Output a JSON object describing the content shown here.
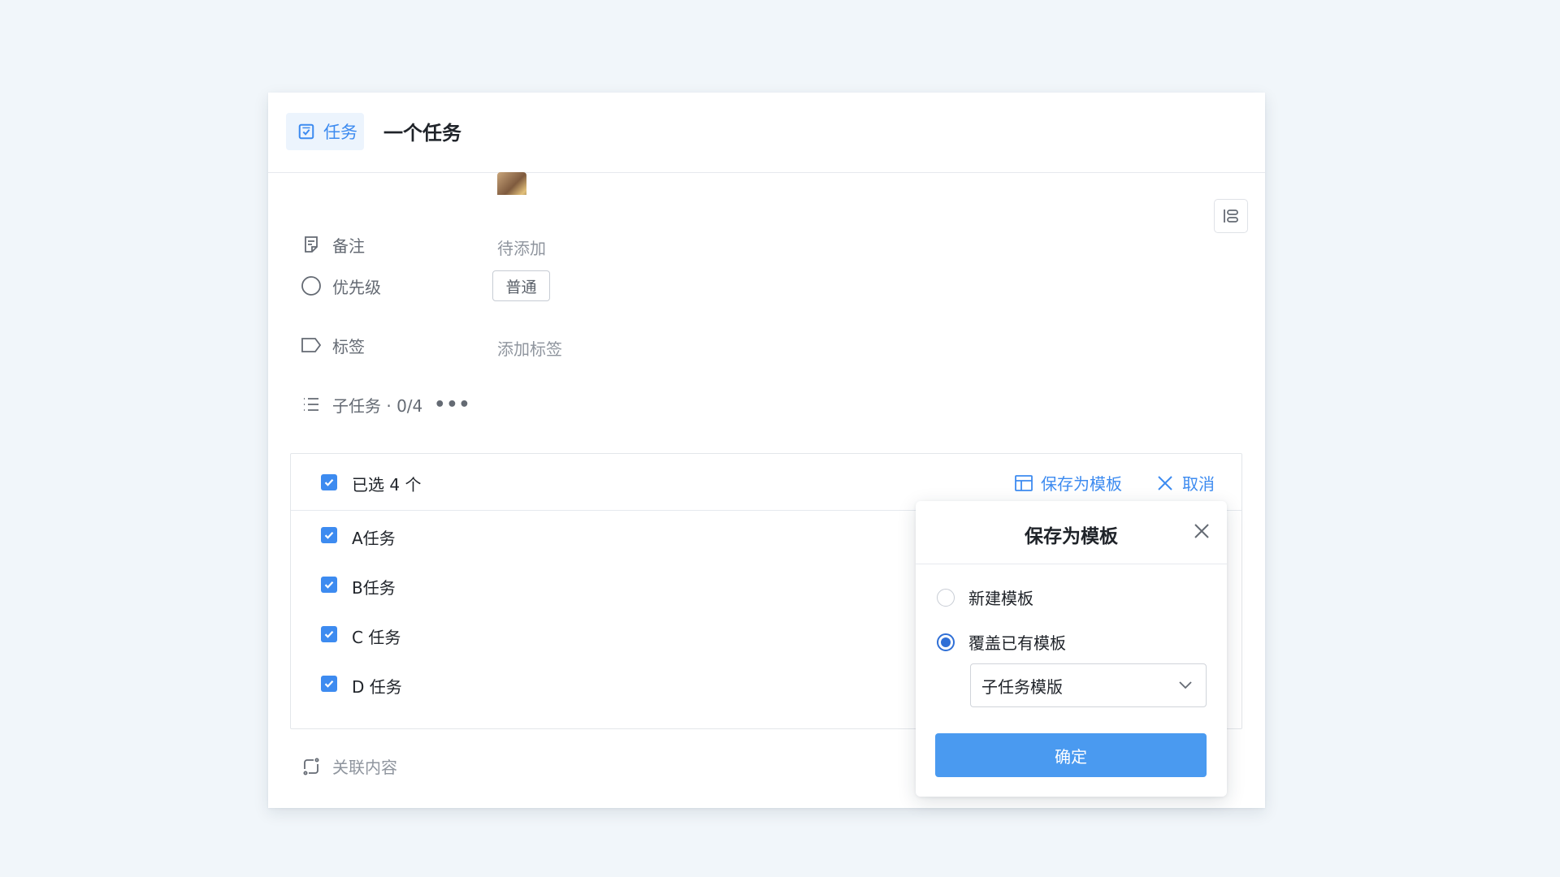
{
  "header": {
    "type_label": "任务",
    "title": "一个任务"
  },
  "fields": {
    "note": {
      "label": "备注",
      "value": "待添加"
    },
    "priority": {
      "label": "优先级",
      "value": "普通"
    },
    "tags": {
      "label": "标签",
      "value": "添加标签"
    },
    "subtasks": {
      "label": "子任务 · 0/4",
      "more": "•••"
    },
    "related": {
      "label": "关联内容"
    }
  },
  "subtask_panel": {
    "selected_text": "已选 4 个",
    "save_template": "保存为模板",
    "cancel": "取消",
    "items": [
      {
        "label": "A任务",
        "checked": true
      },
      {
        "label": "B任务",
        "checked": true
      },
      {
        "label": "C 任务",
        "checked": true
      },
      {
        "label": "D 任务",
        "checked": true
      }
    ]
  },
  "popup": {
    "title": "保存为模板",
    "options": [
      {
        "label": "新建模板",
        "selected": false
      },
      {
        "label": "覆盖已有模板",
        "selected": true
      }
    ],
    "select_value": "子任务模版",
    "confirm": "确定"
  },
  "colors": {
    "accent": "#3d8bf0",
    "radio": "#2f6fd6",
    "button": "#4a9af0",
    "background": "#f1f6fa"
  }
}
